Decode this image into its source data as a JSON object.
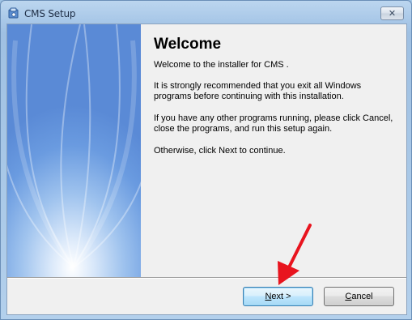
{
  "window": {
    "title": "CMS Setup",
    "close_glyph": "✕",
    "title_icon": "installer-icon"
  },
  "content": {
    "heading": "Welcome",
    "intro": "Welcome to the installer for CMS .",
    "recommend": "It is strongly recommended that you exit all Windows programs before continuing with this installation.",
    "other_programs": "If you have any other programs running, please click Cancel, close the programs, and run this setup again.",
    "otherwise": "Otherwise, click Next to continue."
  },
  "buttons": {
    "next_mnemonic": "N",
    "next_rest": "ext >",
    "cancel_mnemonic": "C",
    "cancel_rest": "ancel"
  },
  "annotation": {
    "arrow_color": "#e8141e",
    "arrow_target": "next-button"
  },
  "colors": {
    "banner_blue": "#6a9be0",
    "dialog_bg": "#f0f0f0",
    "default_button_border": "#3c7fb1"
  }
}
